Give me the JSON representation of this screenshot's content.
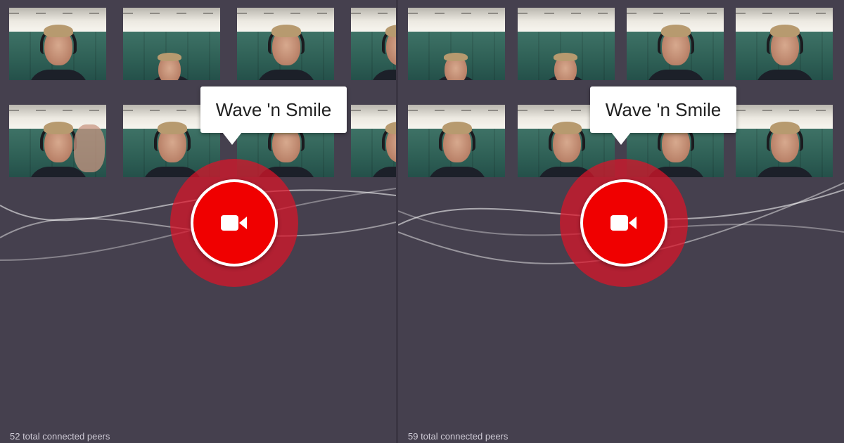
{
  "left_panel": {
    "tooltip_text": "Wave 'n Smile",
    "peer_count_text": "52 total connected peers"
  },
  "right_panel": {
    "tooltip_text": "Wave 'n Smile",
    "peer_count_text": "59 total connected peers"
  },
  "icons": {
    "record": "video-camera-icon"
  },
  "colors": {
    "background": "#45404e",
    "record_red": "#f00000",
    "halo_red": "#dc1428",
    "tooltip_bg": "#ffffff",
    "peer_text": "#cfcbd6"
  }
}
